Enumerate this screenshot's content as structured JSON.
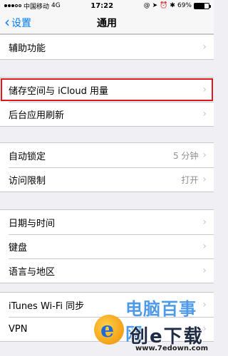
{
  "status_bar": {
    "carrier": "中国移动",
    "network": "4G",
    "time": "17:22",
    "battery": "69%",
    "battery_level": 0.69
  },
  "nav": {
    "back_label": "设置",
    "title": "通用"
  },
  "groups": [
    {
      "rows": [
        {
          "label": "辅助功能",
          "value": ""
        }
      ]
    },
    {
      "rows": [
        {
          "label": "储存空间与 iCloud 用量",
          "value": "",
          "highlighted": true
        },
        {
          "label": "后台应用刷新",
          "value": ""
        }
      ]
    },
    {
      "rows": [
        {
          "label": "自动锁定",
          "value": "5 分钟"
        },
        {
          "label": "访问限制",
          "value": "打开"
        }
      ]
    },
    {
      "rows": [
        {
          "label": "日期与时间",
          "value": ""
        },
        {
          "label": "键盘",
          "value": ""
        },
        {
          "label": "语言与地区",
          "value": ""
        }
      ]
    },
    {
      "rows": [
        {
          "label": "iTunes Wi-Fi 同步",
          "value": ""
        },
        {
          "label": "VPN",
          "value": ""
        }
      ]
    }
  ],
  "watermark": {
    "site_name": "电脑百事网",
    "site_name2": "创e下载",
    "url": "www.7edown.com"
  },
  "colors": {
    "accent": "#007aff",
    "highlight_border": "#e8141b",
    "background": "#efeff4"
  }
}
